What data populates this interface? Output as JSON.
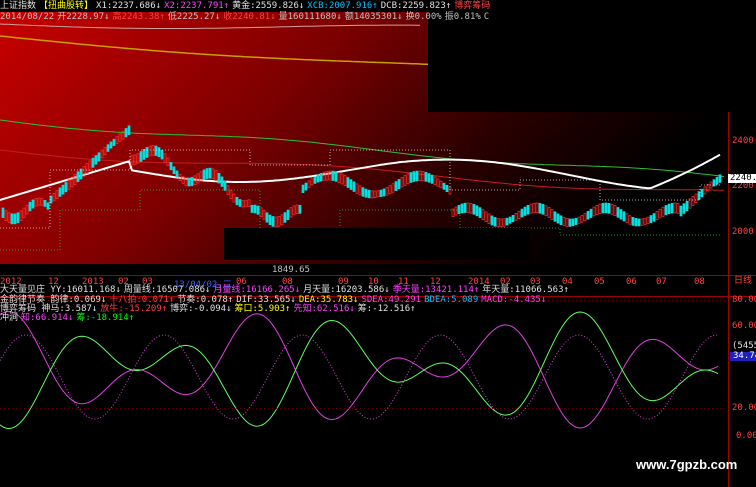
{
  "header": {
    "row1": [
      {
        "text": "上证指数",
        "color": "#e0e0e0"
      },
      {
        "text": "【扭曲股转】",
        "color": "#ffff00"
      },
      {
        "text": "X1:2237.686↓",
        "color": "#e0e0e0"
      },
      {
        "text": "X2:2237.791↑",
        "color": "#ff40ff"
      },
      {
        "text": "黄金:2559.826↓",
        "color": "#e0e0e0"
      },
      {
        "text": "XCB:2007.916↑",
        "color": "#00c0ff"
      },
      {
        "text": "DCB:2259.823↑",
        "color": "#e0e0e0"
      },
      {
        "text": "博弈筹码",
        "color": "#ff4040"
      }
    ],
    "row2": [
      {
        "text": "2014/08/22",
        "color": "#c0c0c0"
      },
      {
        "text": "开2228.97↓",
        "color": "#c0c0c0"
      },
      {
        "text": "高2243.38↑",
        "color": "#ff4040"
      },
      {
        "text": "低2225.27↓",
        "color": "#c0c0c0"
      },
      {
        "text": "收2240.81↓",
        "color": "#ff4040"
      },
      {
        "text": "量160111680↓",
        "color": "#c0c0c0"
      },
      {
        "text": "额14035301↓",
        "color": "#c0c0c0"
      },
      {
        "text": "换0.00%",
        "color": "#c0c0c0"
      },
      {
        "text": "振0.81%",
        "color": "#c0c0c0"
      },
      {
        "text": "C",
        "color": "#c0c0c0"
      }
    ]
  },
  "price_axis": {
    "ticks": [
      "2400.",
      "2200.",
      "2000."
    ],
    "current_price": "2240.8",
    "low_label": "1849.65"
  },
  "time_axis": {
    "labels": [
      "2012",
      "12",
      "2013",
      "02",
      "03",
      "13/04/02,二",
      "06",
      "08",
      "09",
      "10",
      "11",
      "12",
      "2014",
      "02",
      "03",
      "04",
      "05",
      "06",
      "07",
      "08"
    ],
    "period": "日线"
  },
  "indicator_rows": [
    [
      {
        "text": "大天量见庄 YY:16011.168↓",
        "color": "#e0e0e0"
      },
      {
        "text": "周量线:16507.086↓",
        "color": "#e0e0e0"
      },
      {
        "text": "月量线:16166.265↓",
        "color": "#ff40ff"
      },
      {
        "text": "月天量:16203.586↓",
        "color": "#e0e0e0"
      },
      {
        "text": "季天量:13421.114↑",
        "color": "#ff40ff"
      },
      {
        "text": "年天量:11066.563↑",
        "color": "#e0e0e0"
      }
    ],
    [
      {
        "text": "金韵律节奏 韵律:0.069↓",
        "color": "#e0e0e0"
      },
      {
        "text": "十八拍:0.071↑",
        "color": "#ff4040"
      },
      {
        "text": "节奏:0.078↑",
        "color": "#e0e0e0"
      },
      {
        "text": "DIF:33.565↓",
        "color": "#e0e0e0"
      },
      {
        "text": "DEA:35.783↓",
        "color": "#ffff00"
      },
      {
        "text": "SDEA:49.291",
        "color": "#ff40ff"
      },
      {
        "text": "BDEA:5.089",
        "color": "#00c0ff"
      },
      {
        "text": "MACD:-4.435↓",
        "color": "#ff40ff"
      }
    ],
    [
      {
        "text": "博弈筹码 神马:3.587↓",
        "color": "#e0e0e0"
      },
      {
        "text": "放牛:-15.209↑",
        "color": "#ff4040"
      },
      {
        "text": "博弈:-0.094↓",
        "color": "#e0e0e0"
      },
      {
        "text": "筹口:5.903↑",
        "color": "#ffff00"
      },
      {
        "text": "先知:62.516↓",
        "color": "#ff40ff"
      },
      {
        "text": "筹:-12.516↑",
        "color": "#e0e0e0"
      }
    ],
    [
      {
        "text": "冲涧",
        "color": "#e0e0e0"
      },
      {
        "text": "知:66.914↓",
        "color": "#ff40ff"
      },
      {
        "text": "筹:-18.914↑",
        "color": "#00ff00"
      }
    ]
  ],
  "oscillator_axis": {
    "ticks": [
      "80.00",
      "60.00",
      "20.00",
      "0.00"
    ],
    "badge_top": "(5455)",
    "badge_value": "34.74"
  },
  "watermark": "www.7gpzb.com",
  "colors": {
    "bull": "#ff3030",
    "bear": "#00e0e0",
    "ma_white": "#ffffff",
    "ma_gold": "#c8a000",
    "ma_green": "#30c030",
    "ma_red": "#c02020",
    "osc_magenta": "#e040e0",
    "osc_green": "#60ff60"
  }
}
